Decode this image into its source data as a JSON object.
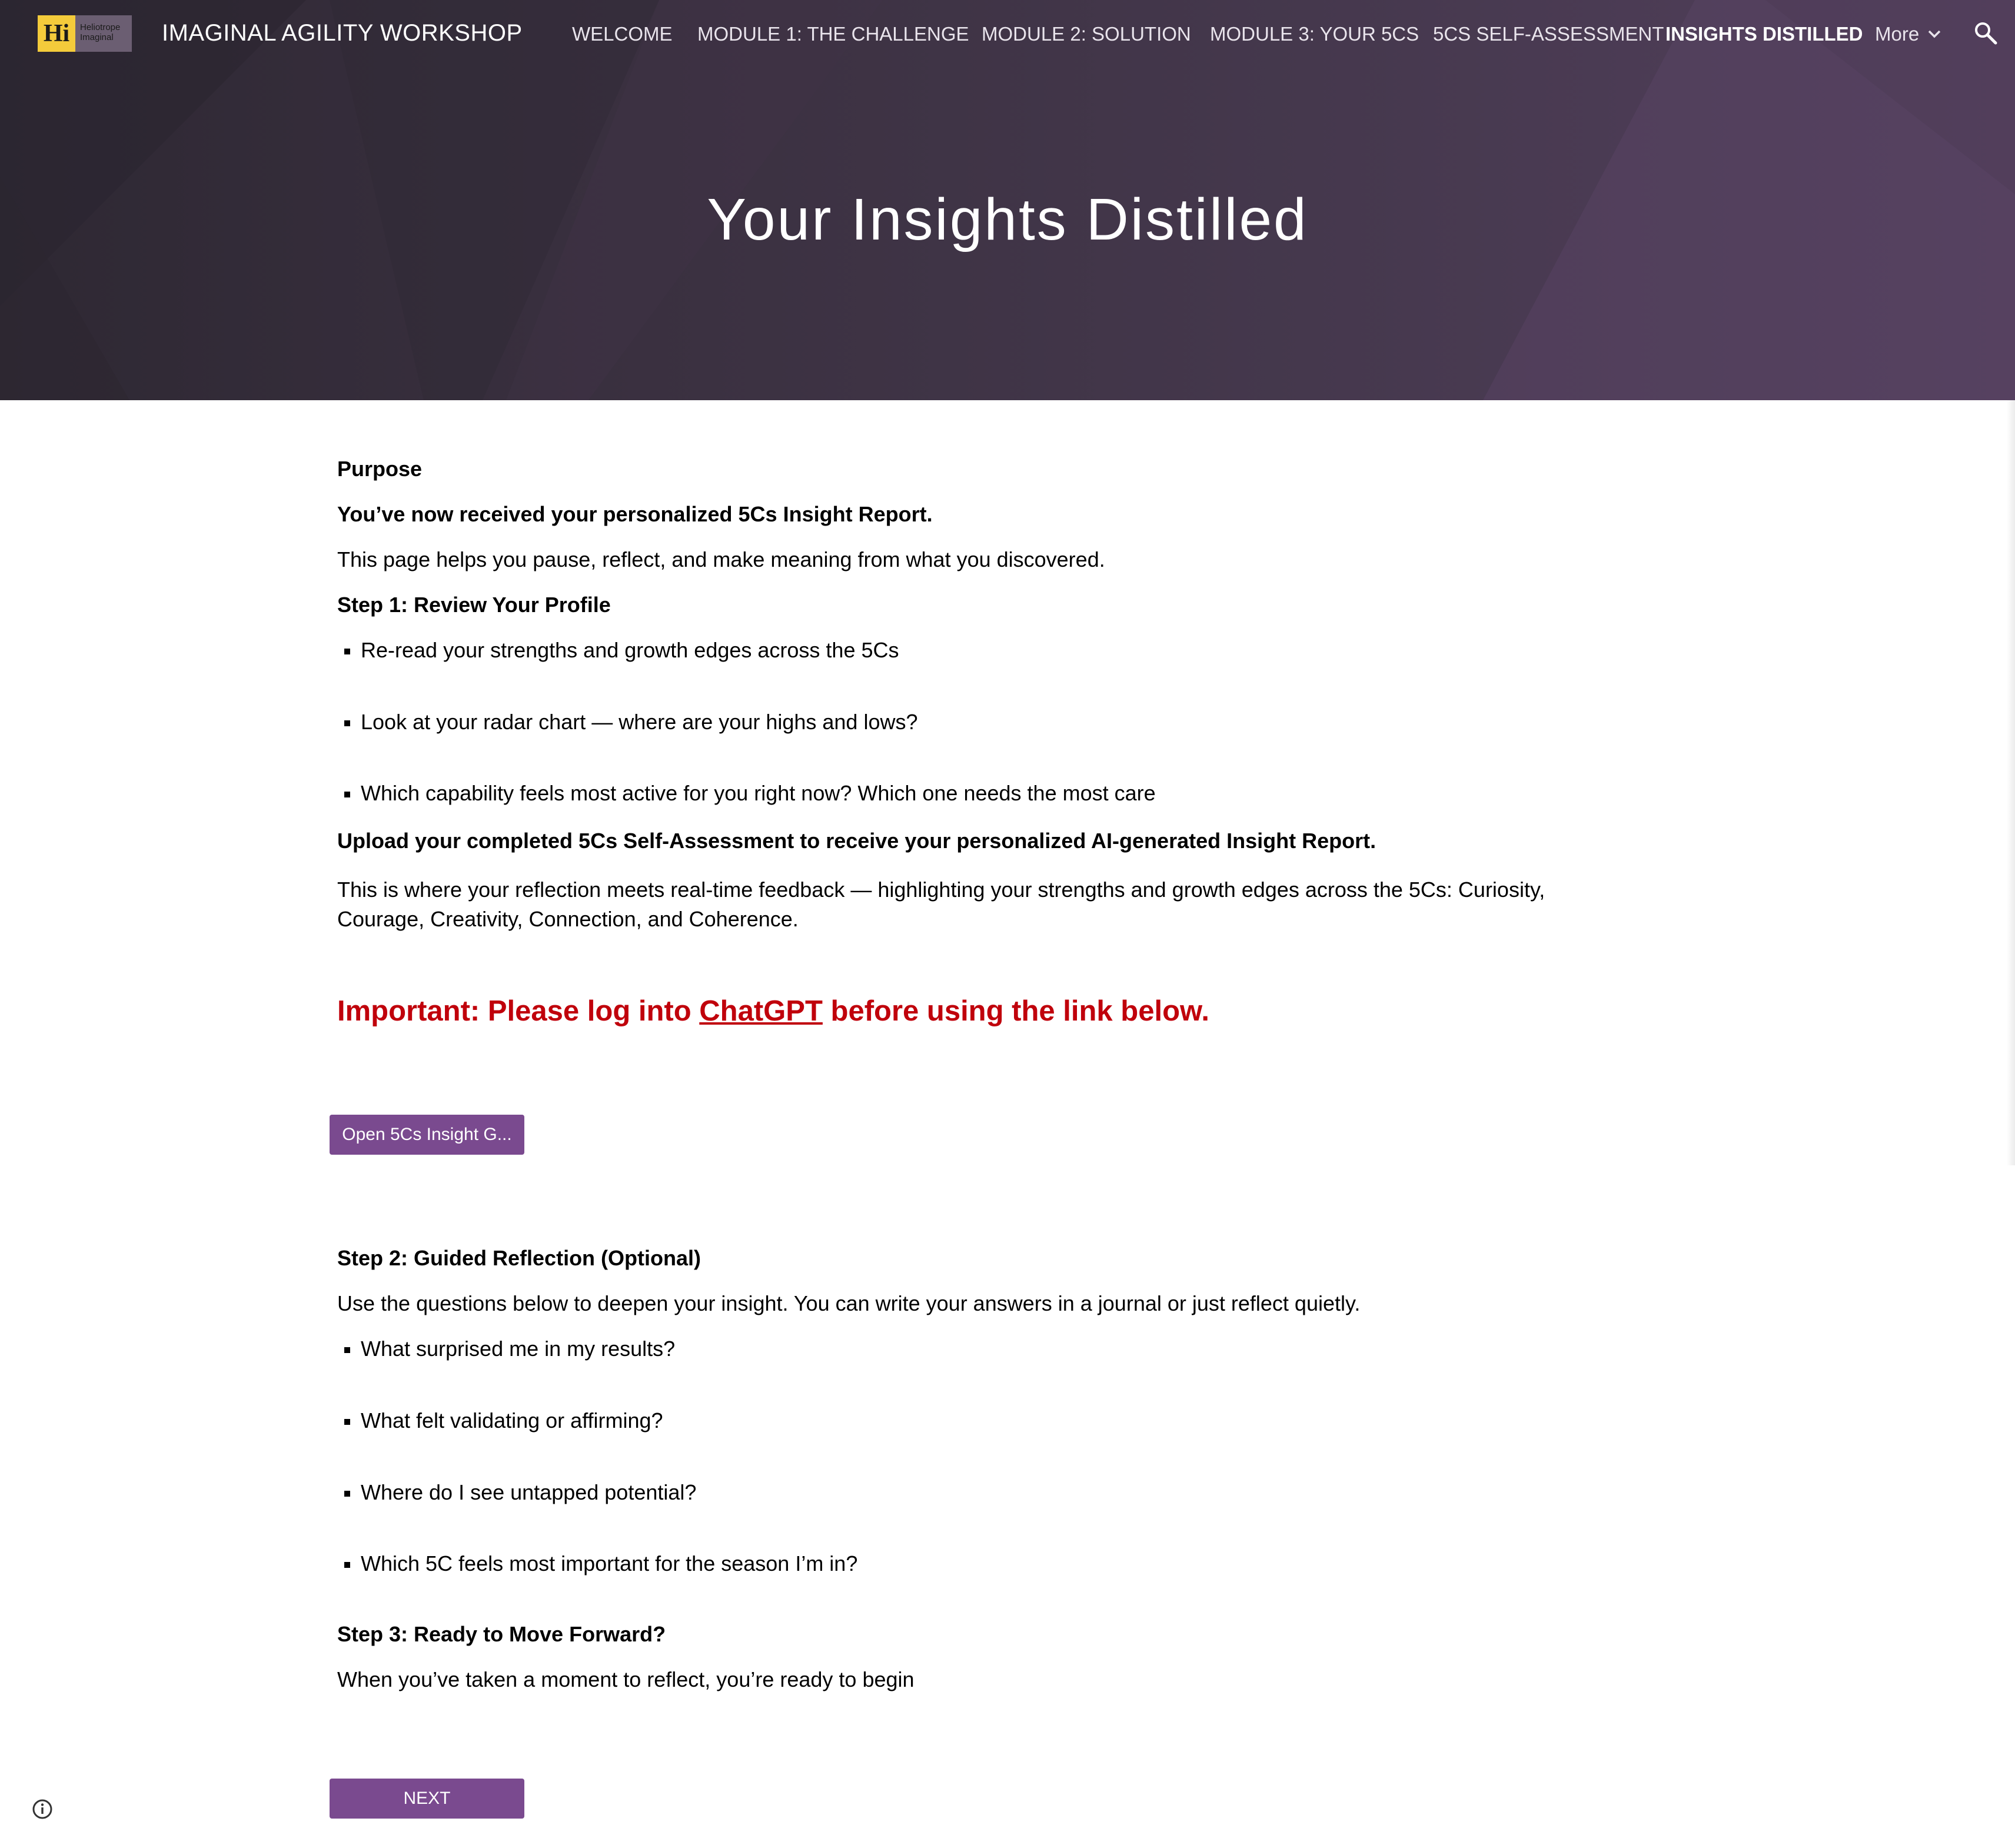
{
  "header": {
    "logo_letters": "Hi",
    "logo_line1": "Heliotrope",
    "logo_line2": "Imaginal",
    "site_title": "IMAGINAL AGILITY WORKSHOP",
    "page_title": "Your Insights Distilled",
    "nav": [
      {
        "label": "WELCOME",
        "active": false
      },
      {
        "label": "MODULE 1: THE CHALLENGE",
        "active": false
      },
      {
        "label": "MODULE 2: SOLUTION",
        "active": false
      },
      {
        "label": "MODULE 3: YOUR 5CS",
        "active": false
      },
      {
        "label": "5CS SELF-ASSESSMENT",
        "active": false
      },
      {
        "label": "INSIGHTS DISTILLED",
        "active": true
      },
      {
        "label": "More",
        "active": false
      }
    ],
    "icons": {
      "search": "search-icon",
      "more": "chevron-down-icon"
    },
    "colors": {
      "logo": "#f4cb3b",
      "accent": "#7a4a8f",
      "important": "#c0000b"
    }
  },
  "content": {
    "purpose_heading": "Purpose",
    "received_line": "You’ve now received your personalized 5Cs Insight Report.",
    "intro": "This page helps you pause, reflect, and make meaning from what you discovered.",
    "step1_heading": "Step 1: Review Your Profile",
    "step1_items": [
      "Re-read your strengths and growth edges across the 5Cs",
      "Look at your radar chart — where are your highs and lows?",
      "Which capability feels most active for you right now? Which one needs the most care"
    ],
    "upload_heading": "Upload your completed 5Cs Self-Assessment to receive your personalized AI-generated Insight Report.",
    "feedback_line1": "This is where your reflection meets real-time feedback — highlighting your strengths and growth edges across the 5Cs: Curiosity,",
    "feedback_line2": "Courage, Creativity, Connection, and Coherence.",
    "important_prefix": "Important: Please log into ",
    "important_link": "ChatGPT",
    "important_suffix": " before using the link below.",
    "open_button": "Open 5Cs Insight G...",
    "step2_heading": "Step 2: Guided Reflection (Optional)",
    "step2_intro": "Use the questions below to deepen your insight. You can write your answers in a journal or just reflect quietly.",
    "step2_items": [
      "What surprised me in my results?",
      "What felt validating or affirming?",
      "Where do I see untapped potential?",
      "Which 5C feels most important for the season I’m in?"
    ],
    "step3_heading": "Step 3: Ready to Move Forward?",
    "step3_text": "When you’ve taken a moment to reflect, you’re ready to begin",
    "next_button": "NEXT"
  },
  "footer": {
    "info_icon": "info-icon"
  }
}
